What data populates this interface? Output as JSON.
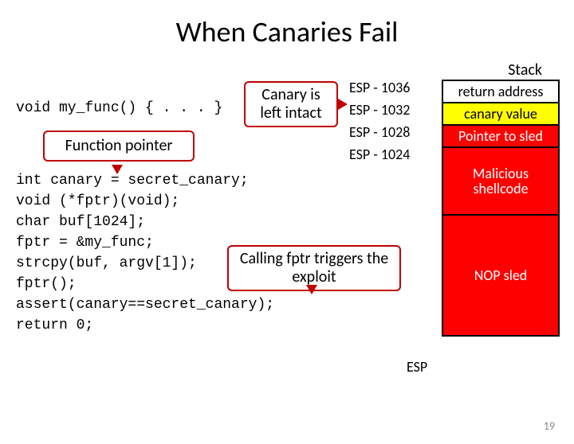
{
  "title": "When Canaries Fail",
  "stack_label": "Stack",
  "code_decl": "void my_func() { . . . }",
  "callouts": {
    "canary": "Canary is left intact",
    "fptr": "Function pointer",
    "trigger": "Calling fptr triggers the exploit"
  },
  "esp_offsets": [
    "ESP - 1036",
    "ESP - 1032",
    "ESP - 1028",
    "ESP - 1024"
  ],
  "stack_cells": {
    "ret": "return address",
    "canary": "canary value",
    "ptr": "Pointer to sled",
    "shell": "Malicious shellcode",
    "nop": "NOP sled"
  },
  "code_body": "int canary = secret_canary;\nvoid (*fptr)(void);\nchar buf[1024];\nfptr = &my_func;\nstrcpy(buf, argv[1]);\nfptr();\nassert(canary==secret_canary);\nreturn 0;",
  "esp_bottom": "ESP",
  "page_num": "19"
}
